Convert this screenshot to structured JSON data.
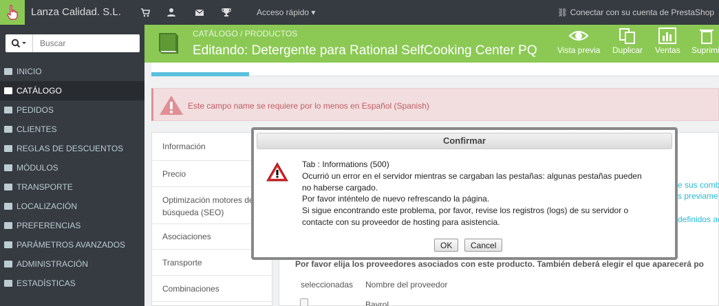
{
  "topbar": {
    "shop_name": "Lanza Calidad. S.L.",
    "quick_access": "Acceso rápido",
    "connect": "Conectar con su cuenta de PrestaShop"
  },
  "sidebar": {
    "search_placeholder": "Buscar",
    "items": [
      {
        "label": "INICIO",
        "icon": "dashboard-icon"
      },
      {
        "label": "CATÁLOGO",
        "icon": "book-icon"
      },
      {
        "label": "PEDIDOS",
        "icon": "credit-card-icon"
      },
      {
        "label": "CLIENTES",
        "icon": "users-icon"
      },
      {
        "label": "REGLAS DE DESCUENTOS",
        "icon": "tags-icon"
      },
      {
        "label": "MÓDULOS",
        "icon": "puzzle-icon"
      },
      {
        "label": "TRANSPORTE",
        "icon": "truck-icon"
      },
      {
        "label": "LOCALIZACIÓN",
        "icon": "globe-icon"
      },
      {
        "label": "PREFERENCIAS",
        "icon": "wrench-icon"
      },
      {
        "label": "PARÁMETROS AVANZADOS",
        "icon": "cogs-icon"
      },
      {
        "label": "ADMINISTRACIÓN",
        "icon": "cog-icon"
      },
      {
        "label": "ESTADÍSTICAS",
        "icon": "bar-chart-icon"
      }
    ]
  },
  "header": {
    "breadcrumb": "CATÁLOGO   /   PRODUCTOS",
    "title": "Editando: Detergente para Rational SelfCooking Center PQ",
    "buttons": [
      "Vista previa",
      "Duplicar",
      "Ventas",
      "Suprimir"
    ]
  },
  "alert": {
    "text": "Este campo name se requiere por lo menos en Español (Spanish)"
  },
  "tabs": [
    "Información",
    "Precio",
    "Optimización motores de búsqueda (SEO)",
    "Asociaciones",
    "Transporte",
    "Combinaciones"
  ],
  "content": {
    "partial_1": "e sus comb",
    "partial_2": "s previame",
    "partial_3": "definidos ac",
    "suppliers_text": "Por favor elija los proveedores asociados con este producto. También deberá elegir el que aparecerá po",
    "col_selected": "seleccionadas",
    "col_supplier": "Nombre del proveedor",
    "row_supplier": "Bayrol"
  },
  "dialog": {
    "title": "Confirmar",
    "lines": [
      "Tab : Informations (500)",
      "Ocurrió un error en el servidor mientras se cargaban las pestañas: algunas pestañas pueden",
      "no haberse cargado.",
      "Por favor inténtelo de nuevo refrescando la página.",
      "Si sigue encontrando este problema, por favor, revise los registros (logs) de su servidor o",
      "contacte con su proveedor de hosting para asistencia."
    ],
    "ok": "OK",
    "cancel": "Cancel"
  }
}
